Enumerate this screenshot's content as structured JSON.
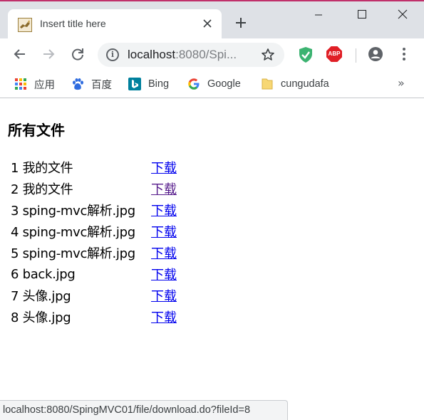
{
  "browser": {
    "tab": {
      "title": "Insert title here",
      "favicon": "tomcat-icon",
      "close_icon": "close-icon"
    },
    "new_tab_icon": "plus-icon",
    "window_controls": [
      "minimize-icon",
      "maximize-icon",
      "close-icon"
    ],
    "toolbar": {
      "back_icon": "arrow-left-icon",
      "forward_icon": "arrow-right-icon",
      "reload_icon": "reload-icon",
      "address": {
        "host": "localhost",
        "rest": ":8080/Spi...",
        "info_icon": "info-icon",
        "star_icon": "star-icon"
      },
      "extensions": [
        "shield-extension-icon",
        "adblock-plus-icon"
      ],
      "abp_label": "ABP",
      "profile_icon": "account-icon",
      "menu_icon": "kebab-menu-icon"
    },
    "bookmarks": [
      {
        "label": "应用",
        "icon": "apps-grid-icon"
      },
      {
        "label": "百度",
        "icon": "baidu-paw-icon"
      },
      {
        "label": "Bing",
        "icon": "bing-icon"
      },
      {
        "label": "Google",
        "icon": "google-icon"
      },
      {
        "label": "cungudafa",
        "icon": "folder-icon"
      }
    ],
    "bookmarks_more": "»",
    "status_url": "localhost:8080/SpingMVC01/file/download.do?fileId=8"
  },
  "page": {
    "heading": "所有文件",
    "download_label": "下载",
    "files": [
      {
        "id": "1",
        "name": "我的文件",
        "visited": false
      },
      {
        "id": "2",
        "name": "我的文件",
        "visited": true
      },
      {
        "id": "3",
        "name": "sping-mvc解析.jpg",
        "visited": false
      },
      {
        "id": "4",
        "name": "sping-mvc解析.jpg",
        "visited": false
      },
      {
        "id": "5",
        "name": "sping-mvc解析.jpg",
        "visited": false
      },
      {
        "id": "6",
        "name": "back.jpg",
        "visited": false
      },
      {
        "id": "7",
        "name": "头像.jpg",
        "visited": false
      },
      {
        "id": "8",
        "name": "头像.jpg",
        "visited": false
      }
    ]
  },
  "colors": {
    "link": "#0000ee",
    "visited_link": "#551a8b",
    "chrome_frame": "#dee1e6"
  }
}
